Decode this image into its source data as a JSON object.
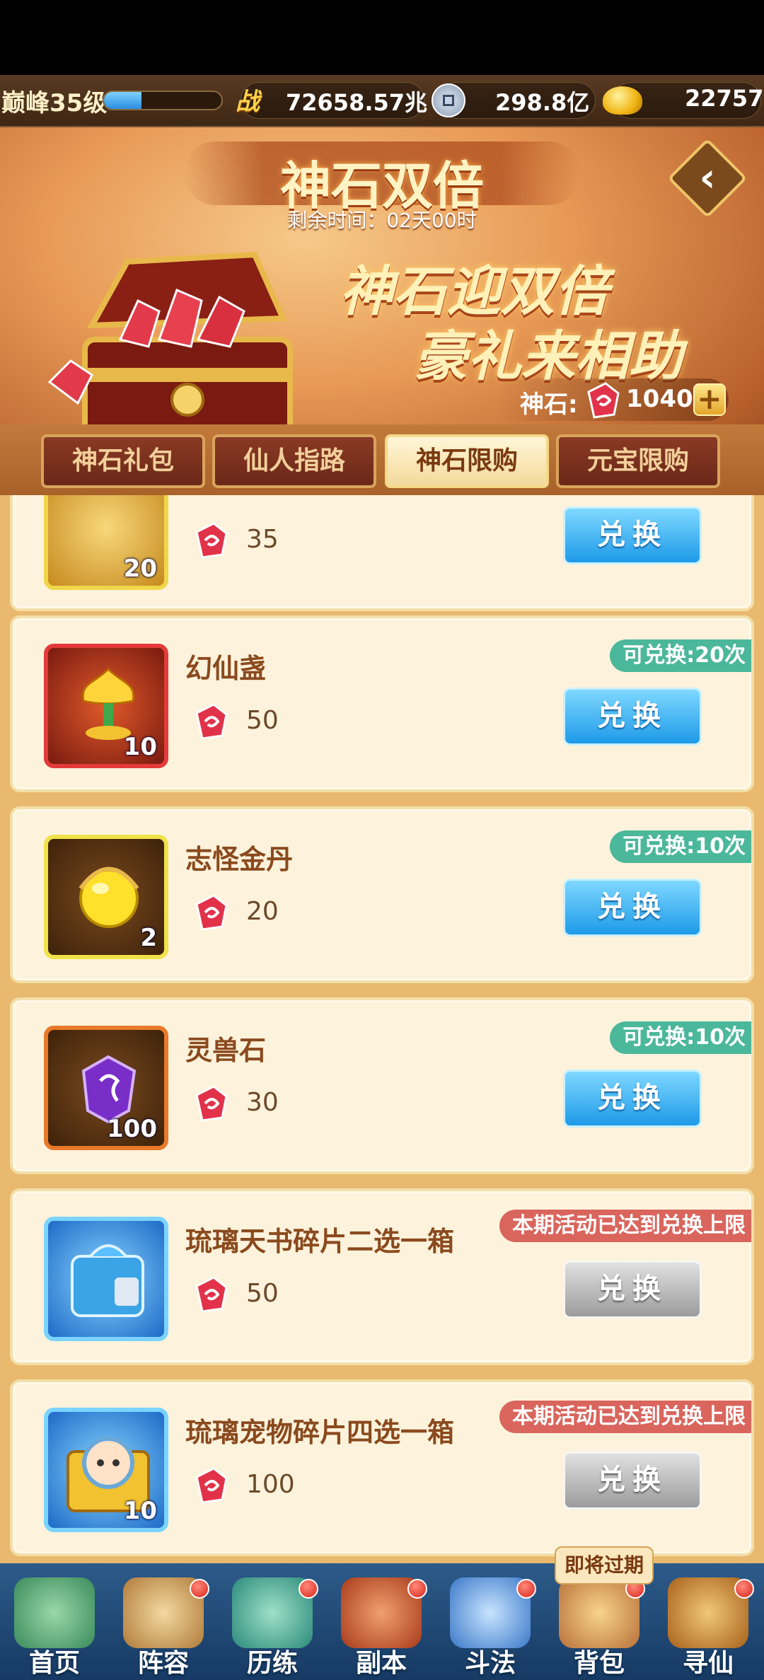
{
  "topbar": {
    "level": "巅峰35级",
    "exp_fraction": 0.32,
    "power_icon": "战",
    "power": "72658.57兆",
    "silver": "298.8亿",
    "gold": "22757"
  },
  "banner": {
    "title": "神石双倍",
    "remaining": "剩余时间：02天00时",
    "slogan_line1": "神石迎双倍",
    "slogan_line2": "豪礼来相助",
    "stone_label": "神石:",
    "stone_count": "1040",
    "plus": "+"
  },
  "tabs": [
    {
      "label": "神石礼包"
    },
    {
      "label": "仙人指路"
    },
    {
      "label": "神石限购"
    },
    {
      "label": "元宝限购"
    }
  ],
  "items": [
    {
      "name": "",
      "count": "20",
      "cost": "35",
      "button": "兑换",
      "badge": "",
      "icon_color": "#e0a430"
    },
    {
      "name": "幻仙盏",
      "count": "10",
      "cost": "50",
      "button": "兑换",
      "badge": "可兑换:20次",
      "icon_color": "#b8341e"
    },
    {
      "name": "志怪金丹",
      "count": "2",
      "cost": "20",
      "button": "兑换",
      "badge": "可兑换:10次",
      "icon_color": "#e4b42a"
    },
    {
      "name": "灵兽石",
      "count": "100",
      "cost": "30",
      "button": "兑换",
      "badge": "可兑换:10次",
      "icon_color": "#7a2ec8"
    },
    {
      "name": "琉璃天书碎片二选一箱",
      "count": "",
      "cost": "50",
      "button": "兑换",
      "badge": "本期活动已达到兑换上限",
      "icon_color": "#3aa4e6"
    },
    {
      "name": "琉璃宠物碎片四选一箱",
      "count": "10",
      "cost": "100",
      "button": "兑换",
      "badge": "本期活动已达到兑换上限",
      "icon_color": "#4ab0ea"
    }
  ],
  "nav": [
    {
      "label": "首页",
      "icon": "home-icon"
    },
    {
      "label": "阵容",
      "icon": "lineup-icon"
    },
    {
      "label": "历练",
      "icon": "training-icon"
    },
    {
      "label": "副本",
      "icon": "dungeon-icon"
    },
    {
      "label": "斗法",
      "icon": "battle-icon"
    },
    {
      "label": "背包",
      "icon": "bag-icon"
    },
    {
      "label": "寻仙",
      "icon": "seek-icon"
    }
  ],
  "expire_tip": "即将过期",
  "colors": {
    "button_blue": "#1e9ae8",
    "badge_green": "#4bb79b",
    "badge_red": "#d9655d"
  }
}
